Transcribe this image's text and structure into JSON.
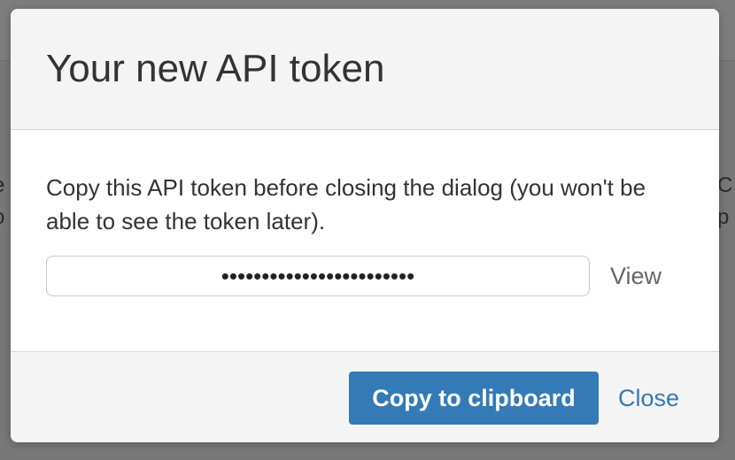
{
  "background": {
    "left_fragment_line1": "e",
    "left_fragment_line2": "o",
    "right_fragment_line1": "C",
    "right_fragment_line2": "p"
  },
  "modal": {
    "title": "Your new API token",
    "message": "Copy this API token before closing the dialog (you won't be able to see the token later).",
    "token_value": "••••••••••••••••••••••••",
    "view_label": "View",
    "copy_button_label": "Copy to clipboard",
    "close_label": "Close"
  },
  "colors": {
    "primary": "#337ab7",
    "overlay": "#7a7a7a",
    "header_bg": "#f4f4f4"
  }
}
